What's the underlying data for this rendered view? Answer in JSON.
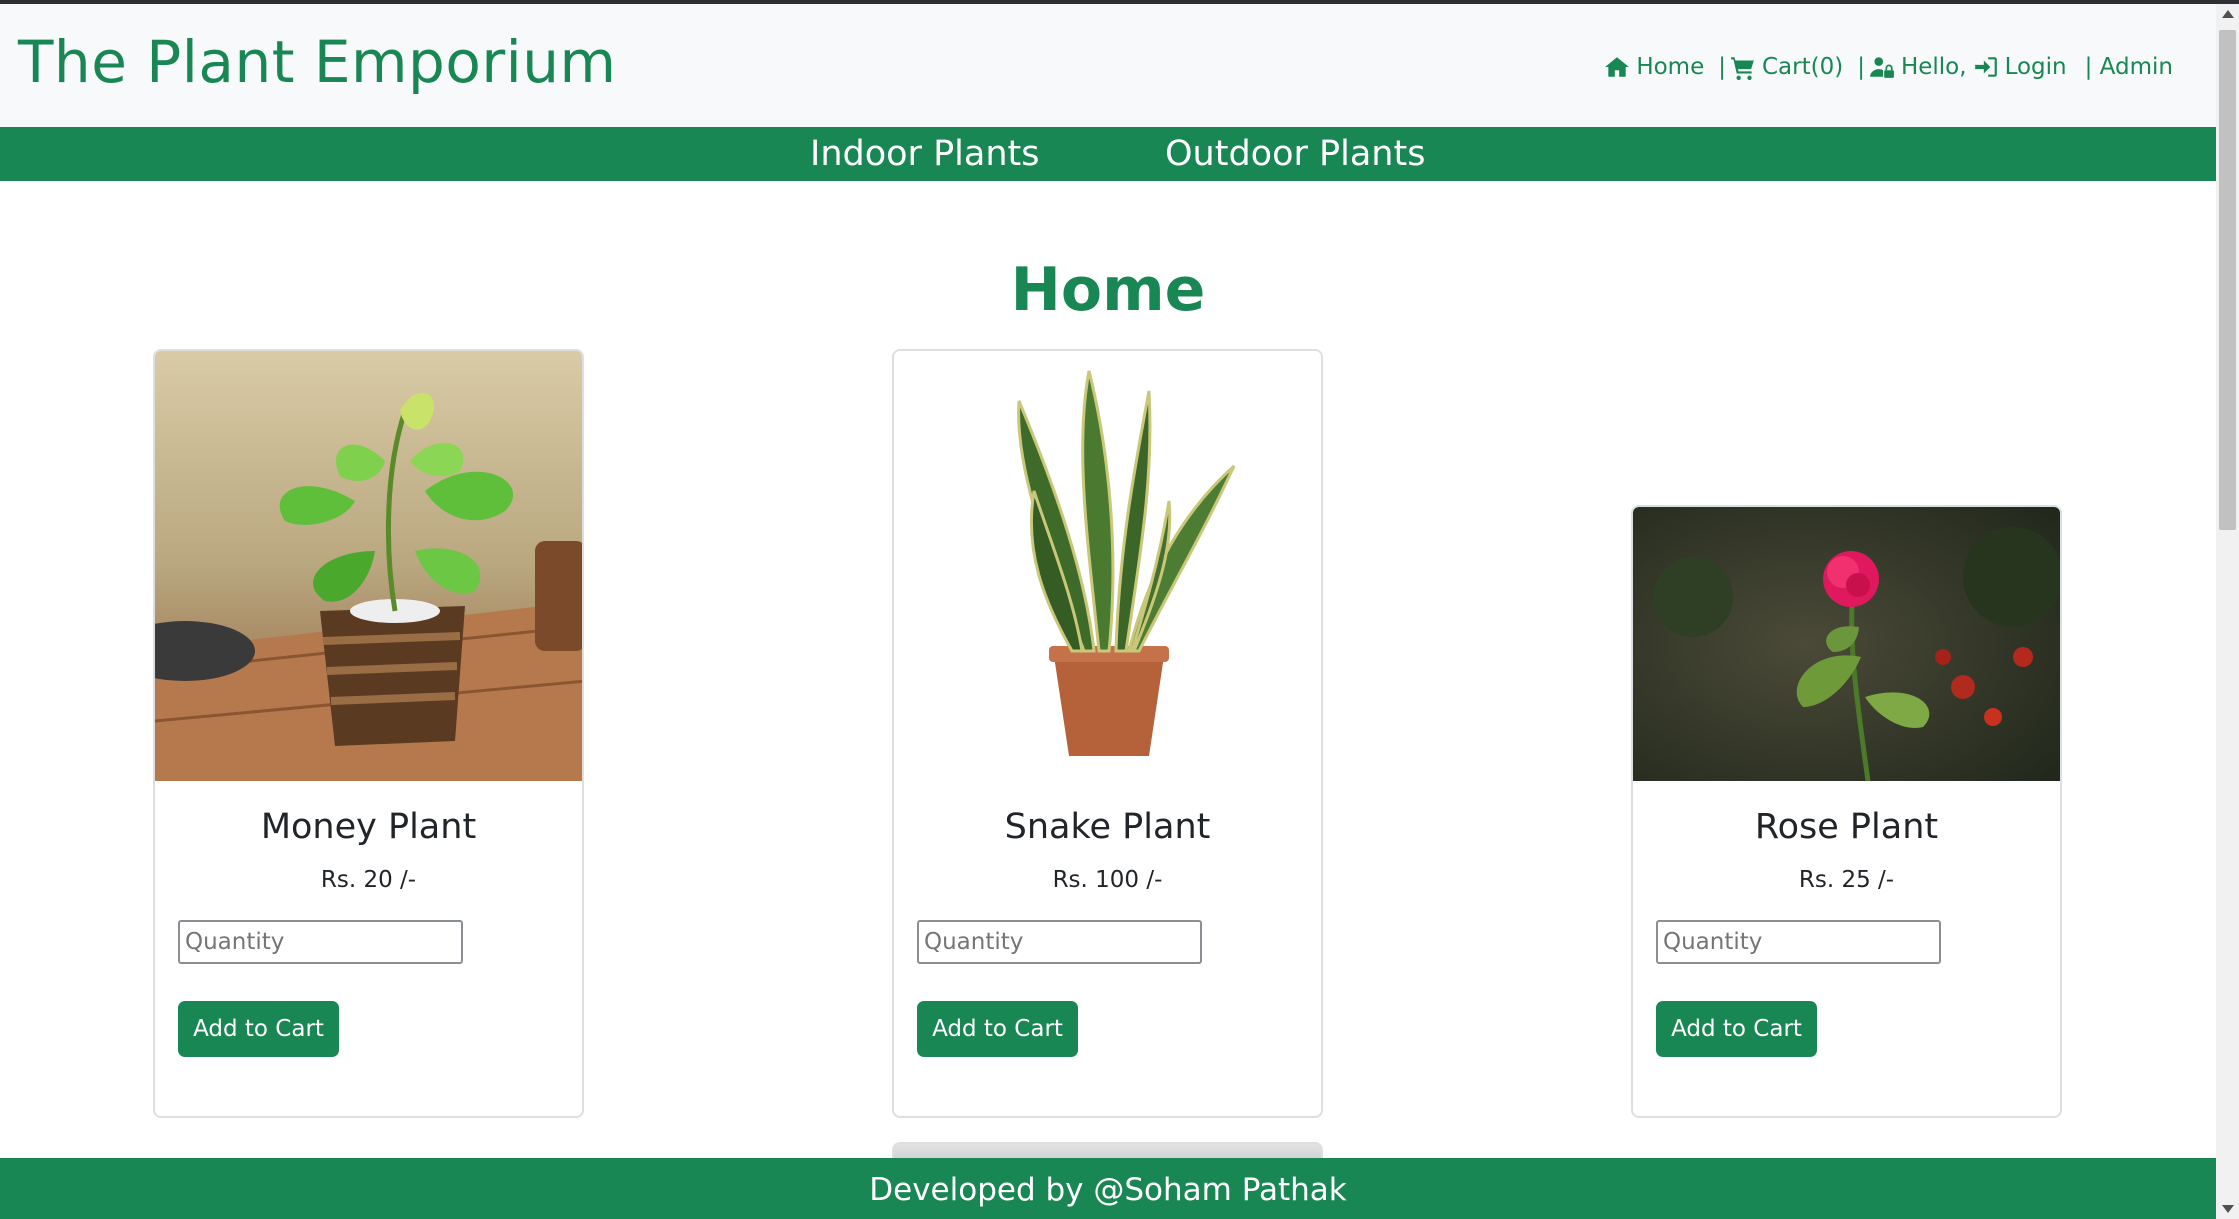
{
  "app": {
    "brand": "The Plant Emporium"
  },
  "topnav": {
    "home": "Home",
    "cart": "Cart(0)",
    "hello": "Hello,",
    "login": "Login",
    "admin": "| Admin",
    "sep": "|"
  },
  "categories": {
    "indoor": "Indoor Plants",
    "outdoor": "Outdoor Plants"
  },
  "page": {
    "title": "Home"
  },
  "products": [
    {
      "name": "Money Plant",
      "price": "Rs. 20 /-",
      "qty_placeholder": "Quantity",
      "button": "Add to Cart"
    },
    {
      "name": "Snake Plant",
      "price": "Rs. 100 /-",
      "qty_placeholder": "Quantity",
      "button": "Add to Cart"
    },
    {
      "name": "Rose Plant",
      "price": "Rs. 25 /-",
      "qty_placeholder": "Quantity",
      "button": "Add to Cart"
    }
  ],
  "footer": {
    "text": "Developed by @Soham Pathak"
  },
  "colors": {
    "accent": "#198754",
    "header_bg": "#f8f9fa"
  },
  "icons": [
    "home-icon",
    "cart-icon",
    "user-lock-icon",
    "sign-in-icon"
  ]
}
